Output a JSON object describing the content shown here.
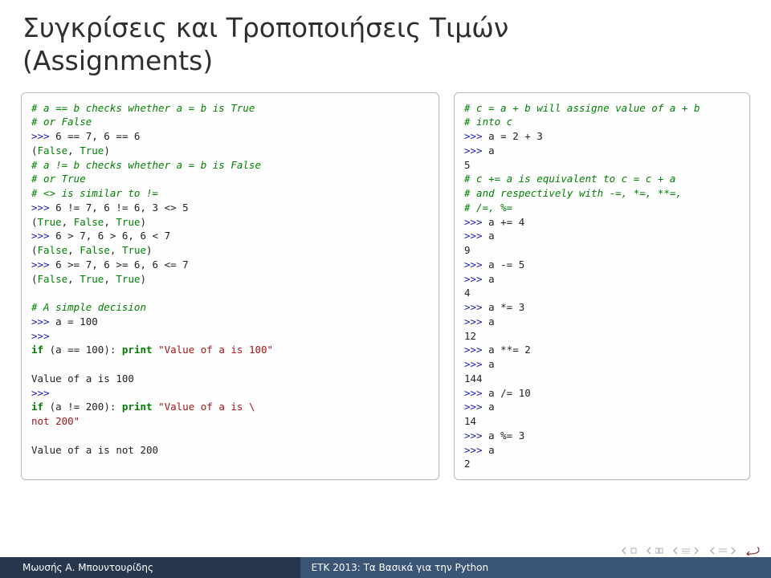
{
  "title": {
    "line1": "Συγκρίσεις και Τροποποιήσεις Τιμών",
    "line2": "(Assignments)"
  },
  "code_left": {
    "l01": "# a == b checks whether a = b is True",
    "l02": "# or False",
    "l03a": ">>>",
    "l03b": " 6 == 7, 6 == 6",
    "l04a": "(",
    "l04b": "False",
    "l04c": ", ",
    "l04d": "True",
    "l04e": ")",
    "l05": "# a != b checks whether a = b is False",
    "l06": "# or True",
    "l07": "# <> is similar to !=",
    "l08a": ">>>",
    "l08b": " 6 != 7, 6 != 6, 3 <> 5",
    "l09a": "(",
    "l09b": "True",
    "l09c": ", ",
    "l09d": "False",
    "l09e": ", ",
    "l09f": "True",
    "l09g": ")",
    "l10a": ">>>",
    "l10b": " 6 > 7, 6 > 6, 6 < 7",
    "l11a": "(",
    "l11b": "False",
    "l11c": ", ",
    "l11d": "False",
    "l11e": ", ",
    "l11f": "True",
    "l11g": ")",
    "l12a": ">>>",
    "l12b": " 6 >= 7, 6 >= 6, 6 <= 7",
    "l13a": "(",
    "l13b": "False",
    "l13c": ", ",
    "l13d": "True",
    "l13e": ", ",
    "l13f": "True",
    "l13g": ")",
    "blank1": "",
    "l14": "# A simple decision",
    "l15a": ">>>",
    "l15b": " a = 100",
    "l16": ">>>",
    "l17a": "if",
    "l17b": " (a == 100): ",
    "l17c": "print",
    "l17d": " ",
    "l17e": "\"Value of a is 100\"",
    "blank2": "",
    "l18": "Value of a is 100",
    "l19": ">>>",
    "l20a": "if",
    "l20b": " (a != 200): ",
    "l20c": "print",
    "l20d": " ",
    "l20e": "\"Value of a is \\",
    "l21": "not 200\"",
    "blank3": "",
    "l22": "Value of a is not 200"
  },
  "code_right": {
    "r01": "# c = a + b will assigne value of a + b",
    "r02": "# into c",
    "r03a": ">>>",
    "r03b": " a = 2 + 3",
    "r04a": ">>>",
    "r04b": " a",
    "r05": "5",
    "r06": "# c += a is equivalent to c = c + a",
    "r07": "# and respectively with -=, *=, **=,",
    "r08": "# /=, %=",
    "r09a": ">>>",
    "r09b": " a += 4",
    "r10a": ">>>",
    "r10b": " a",
    "r11": "9",
    "r12a": ">>>",
    "r12b": " a -= 5",
    "r13a": ">>>",
    "r13b": " a",
    "r14": "4",
    "r15a": ">>>",
    "r15b": " a *= 3",
    "r16a": ">>>",
    "r16b": " a",
    "r17": "12",
    "r18a": ">>>",
    "r18b": " a **= 2",
    "r19a": ">>>",
    "r19b": " a",
    "r20": "144",
    "r21a": ">>>",
    "r21b": " a /= 10",
    "r22a": ">>>",
    "r22b": " a",
    "r23": "14",
    "r24a": ">>>",
    "r24b": " a %= 3",
    "r25a": ">>>",
    "r25b": " a",
    "r26": "2"
  },
  "footer": {
    "author": "Μωυσής Α. Μπουντουρίδης",
    "talk": "ΕΤΚ 2013: Τα Βασικά για την Python"
  }
}
